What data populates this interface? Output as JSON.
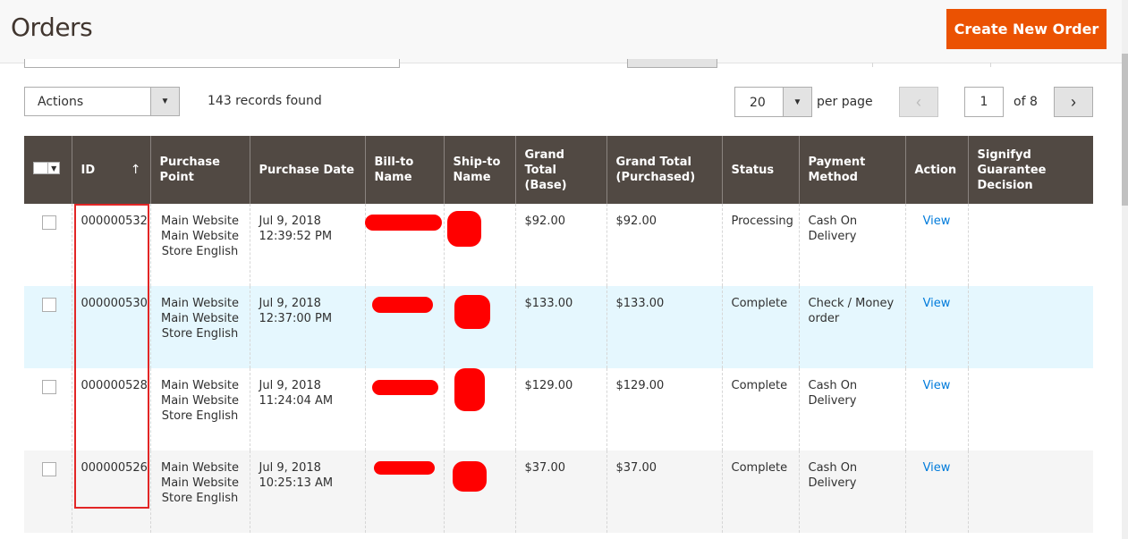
{
  "header": {
    "title": "Orders",
    "create_label": "Create New Order"
  },
  "toolbar": {
    "actions_label": "Actions",
    "records_text": "143 records found",
    "per_page_value": "20",
    "per_page_label": "per page",
    "current_page": "1",
    "total_pages_text": "of 8"
  },
  "grid": {
    "columns": [
      {
        "label": "ID"
      },
      {
        "label": "Purchase Point"
      },
      {
        "label": "Purchase Date"
      },
      {
        "label": "Bill-to Name"
      },
      {
        "label": "Ship-to Name"
      },
      {
        "label": "Grand Total (Base)"
      },
      {
        "label": "Grand Total (Purchased)"
      },
      {
        "label": "Status"
      },
      {
        "label": "Payment Method"
      },
      {
        "label": "Action"
      },
      {
        "label": "Signifyd Guarantee Decision"
      }
    ],
    "sort_icon": "arrow-up-icon",
    "rows": [
      {
        "id": "000000532",
        "point": "Main Website Main Website Store English",
        "date": "Jul 9, 2018 12:39:52 PM",
        "base": "$92.00",
        "purchased": "$92.00",
        "status": "Processing",
        "payment": "Cash On Delivery",
        "action": "View"
      },
      {
        "id": "000000530",
        "point": "Main Website Main Website Store English",
        "date": "Jul 9, 2018 12:37:00 PM",
        "base": "$133.00",
        "purchased": "$133.00",
        "status": "Complete",
        "payment": "Check / Money order",
        "action": "View"
      },
      {
        "id": "000000528",
        "point": "Main Website Main Website Store English",
        "date": "Jul 9, 2018 11:24:04 AM",
        "base": "$129.00",
        "purchased": "$129.00",
        "status": "Complete",
        "payment": "Cash On Delivery",
        "action": "View"
      },
      {
        "id": "000000526",
        "point": "Main Website Main Website Store English",
        "date": "Jul 9, 2018 10:25:13 AM",
        "base": "$37.00",
        "purchased": "$37.00",
        "status": "Complete",
        "payment": "Cash On Delivery",
        "action": "View"
      }
    ]
  },
  "colors": {
    "accent": "#eb5202",
    "header_bg": "#514943",
    "link": "#007bdb",
    "highlight_row": "#e5f7fe",
    "annotation": "#e22626"
  }
}
